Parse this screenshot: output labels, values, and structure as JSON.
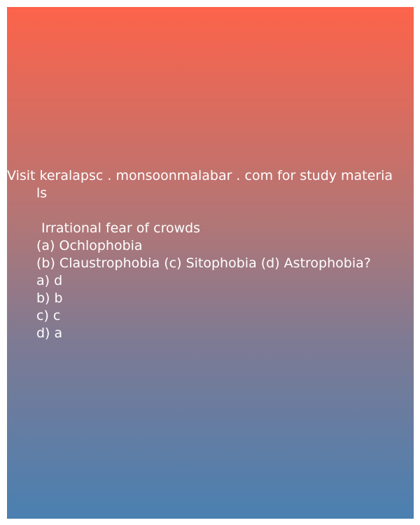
{
  "header": {
    "line1": "Visit keralapsc . monsoonmalabar . com for study materia",
    "line2": "ls"
  },
  "question": {
    "text": "Irrational fear of crowds",
    "option_line1": "(a) Ochlophobia",
    "option_line2": "(b) Claustrophobia (c) Sitophobia (d) Astrophobia?"
  },
  "answers": [
    "a) d",
    "b) b",
    "c) c",
    "d) a"
  ],
  "colors": {
    "gradient_top": "#fd634a",
    "gradient_bottom": "#4a80b1",
    "text": "#ffffff",
    "page_background": "#ffffff"
  }
}
